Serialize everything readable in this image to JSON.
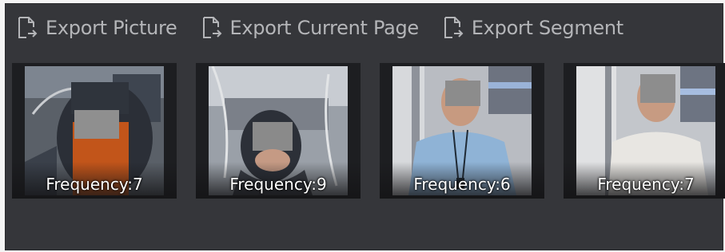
{
  "toolbar": {
    "buttons": [
      {
        "label": "Export Picture",
        "icon": "export-file-icon"
      },
      {
        "label": "Export Current Page",
        "icon": "export-file-icon"
      },
      {
        "label": "Export Segment",
        "icon": "export-file-icon"
      }
    ]
  },
  "results": [
    {
      "frequency_label": "Frequency:",
      "frequency": "7"
    },
    {
      "frequency_label": "Frequency:",
      "frequency": "9"
    },
    {
      "frequency_label": "Frequency:",
      "frequency": "6"
    },
    {
      "frequency_label": "Frequency:",
      "frequency": "7"
    }
  ],
  "colors": {
    "panel_background": "#35363a",
    "thumbnail_background": "#1d1e21",
    "text_muted": "#b4b5b8",
    "text_white": "#ffffff"
  }
}
